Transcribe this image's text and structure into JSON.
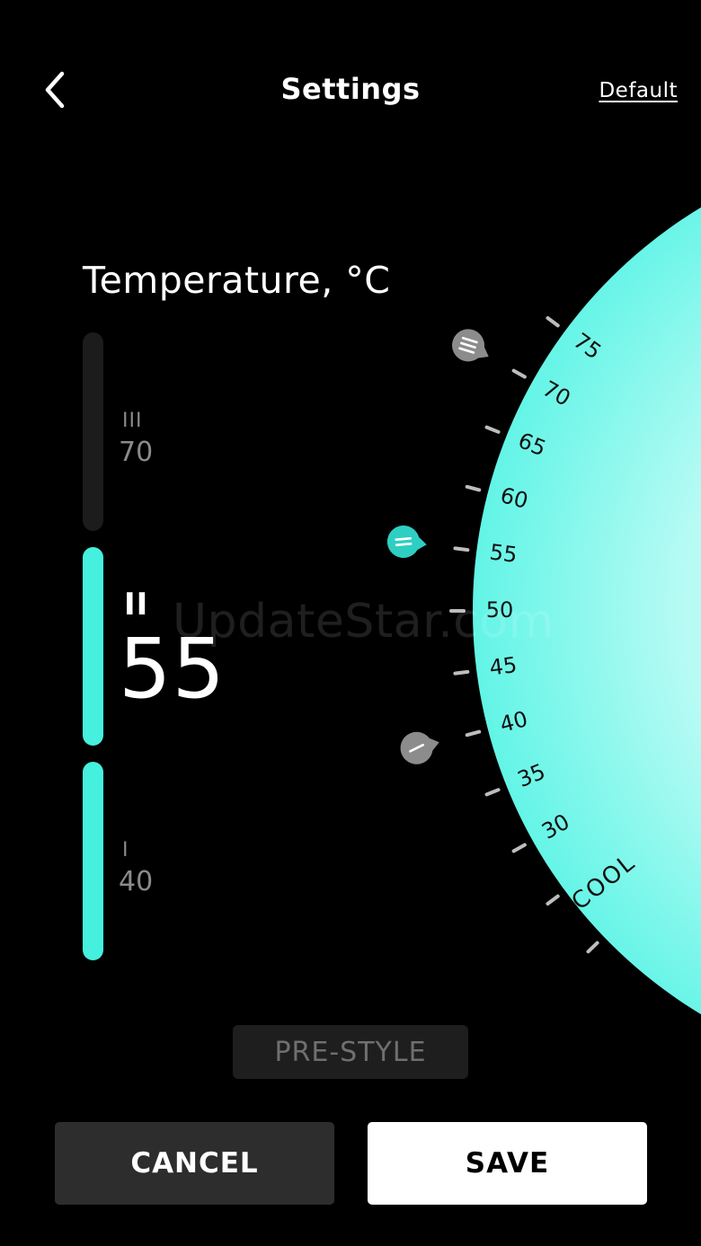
{
  "header": {
    "title": "Settings",
    "default_label": "Default",
    "back_icon": "chevron-left-icon"
  },
  "temperature": {
    "label": "Temperature, °C",
    "levels": [
      {
        "roman": "III",
        "value": "70",
        "active": false
      },
      {
        "roman": "II",
        "value": "55",
        "active": true
      },
      {
        "roman": "I",
        "value": "40",
        "active": false
      }
    ]
  },
  "dial": {
    "ticks": [
      "75",
      "70",
      "65",
      "60",
      "55",
      "50",
      "45",
      "40",
      "35",
      "30"
    ],
    "cool_label": "COOL",
    "markers": [
      {
        "level": "III",
        "value": 70
      },
      {
        "level": "II",
        "value": 55
      },
      {
        "level": "I",
        "value": 40
      }
    ]
  },
  "prestyle_label": "PRE-STYLE",
  "actions": {
    "cancel_label": "CANCEL",
    "save_label": "SAVE"
  },
  "watermark": "UpdateStar.com",
  "colors": {
    "accent": "#45f0df",
    "inactive_bar": "#1c1c1c",
    "marker_inactive": "#8c8c8c",
    "marker_active": "#2ecfc2"
  }
}
